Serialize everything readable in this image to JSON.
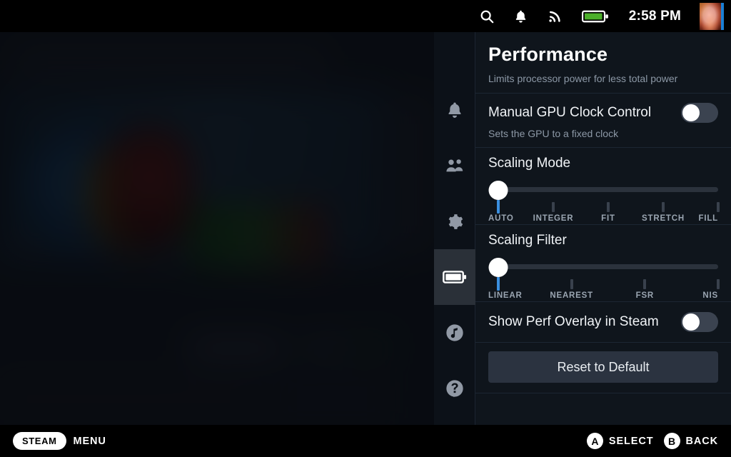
{
  "statusbar": {
    "icons": [
      "search-icon",
      "bell-icon",
      "signal-icon",
      "battery-icon"
    ],
    "time": "2:58 PM",
    "avatar": "user-avatar"
  },
  "sidebar": {
    "items": [
      {
        "name": "notifications",
        "icon": "bell-icon",
        "active": false
      },
      {
        "name": "friends",
        "icon": "people-icon",
        "active": false
      },
      {
        "name": "settings",
        "icon": "gear-icon",
        "active": false
      },
      {
        "name": "performance",
        "icon": "battery-icon",
        "active": true
      },
      {
        "name": "music",
        "icon": "music-note-icon",
        "active": false
      },
      {
        "name": "help",
        "icon": "question-mark-icon",
        "active": false
      }
    ]
  },
  "panel": {
    "title": "Performance",
    "header_subtitle": "Limits processor power for less total power",
    "gpu_clock": {
      "label": "Manual GPU Clock Control",
      "subtitle": "Sets the GPU to a fixed clock",
      "value": "off"
    },
    "scaling_mode": {
      "label": "Scaling Mode",
      "options": [
        "AUTO",
        "INTEGER",
        "FIT",
        "STRETCH",
        "FILL"
      ],
      "selected_index": 0,
      "selected": "AUTO"
    },
    "scaling_filter": {
      "label": "Scaling Filter",
      "options": [
        "LINEAR",
        "NEAREST",
        "FSR",
        "NIS"
      ],
      "selected_index": 0,
      "selected": "LINEAR"
    },
    "perf_overlay": {
      "label": "Show Perf Overlay in Steam",
      "value": "off"
    },
    "reset": {
      "label": "Reset to Default"
    }
  },
  "bottombar": {
    "steam_label": "STEAM",
    "menu_label": "MENU",
    "select_button": "A",
    "select_label": "SELECT",
    "back_button": "B",
    "back_label": "BACK"
  },
  "colors": {
    "accent": "#3a8fe0",
    "panel_bg": "#0f151c",
    "rail_bg": "#0c1118",
    "battery_green": "#4caf2b"
  }
}
